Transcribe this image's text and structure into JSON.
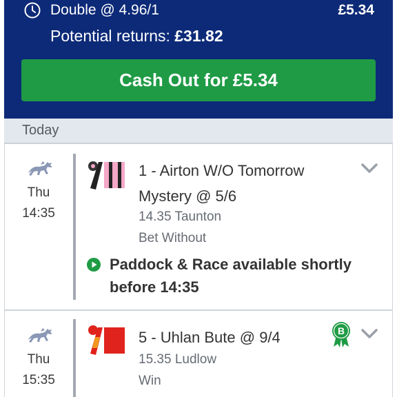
{
  "header": {
    "bet_type": "Double @ 4.96/1",
    "stake": "£5.34",
    "returns_label": "Potential returns:",
    "returns_value": "£31.82",
    "cashout_label": "Cash Out for £5.34"
  },
  "section": {
    "label": "Today"
  },
  "selections": [
    {
      "day": "Thu",
      "time": "14:35",
      "name_line1": "1 - Airton W/O Tomorrow",
      "name_line2": "Mystery @ 5/6",
      "race": "14.35 Taunton",
      "market": "Bet Without",
      "paddock_line1": "Paddock & Race available shortly",
      "paddock_line2": "before 14:35"
    },
    {
      "day": "Thu",
      "time": "15:35",
      "name_line1": "5 - Uhlan Bute @ 9/4",
      "race": "15.35 Ludlow",
      "market": "Win",
      "badge": "B"
    }
  ],
  "colors": {
    "header_bg": "#0d2a78",
    "cashout_bg": "#1f9b45",
    "badge": "#1f9b45"
  }
}
